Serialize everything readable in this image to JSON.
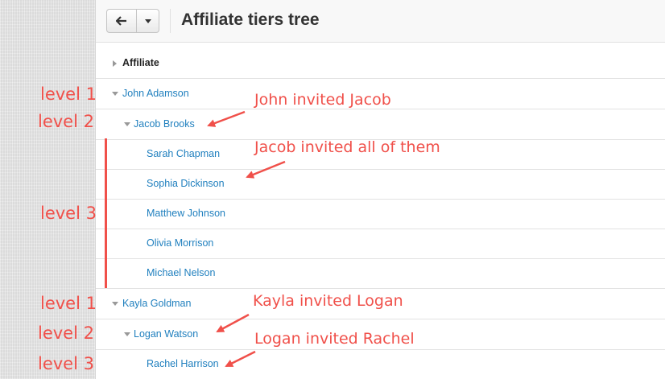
{
  "header": {
    "title": "Affiliate tiers tree",
    "back_icon": "arrow-left-icon",
    "dropdown_icon": "caret-down-icon"
  },
  "tree": {
    "column_header": "Affiliate",
    "rows": [
      {
        "name": "John Adamson"
      },
      {
        "name": "Jacob Brooks"
      },
      {
        "name": "Sarah Chapman"
      },
      {
        "name": "Sophia Dickinson"
      },
      {
        "name": "Matthew Johnson"
      },
      {
        "name": "Olivia Morrison"
      },
      {
        "name": "Michael Nelson"
      },
      {
        "name": "Kayla Goldman"
      },
      {
        "name": "Logan Watson"
      },
      {
        "name": "Rachel Harrison"
      }
    ]
  },
  "annotations": {
    "level_labels": [
      "level 1",
      "level 2",
      "level 3",
      "level 1",
      "level 2",
      "level 3"
    ],
    "notes": [
      "John invited Jacob",
      "Jacob invited all of them",
      "Kayla invited Logan",
      "Logan invited Rachel"
    ],
    "color": "#f0504a"
  }
}
